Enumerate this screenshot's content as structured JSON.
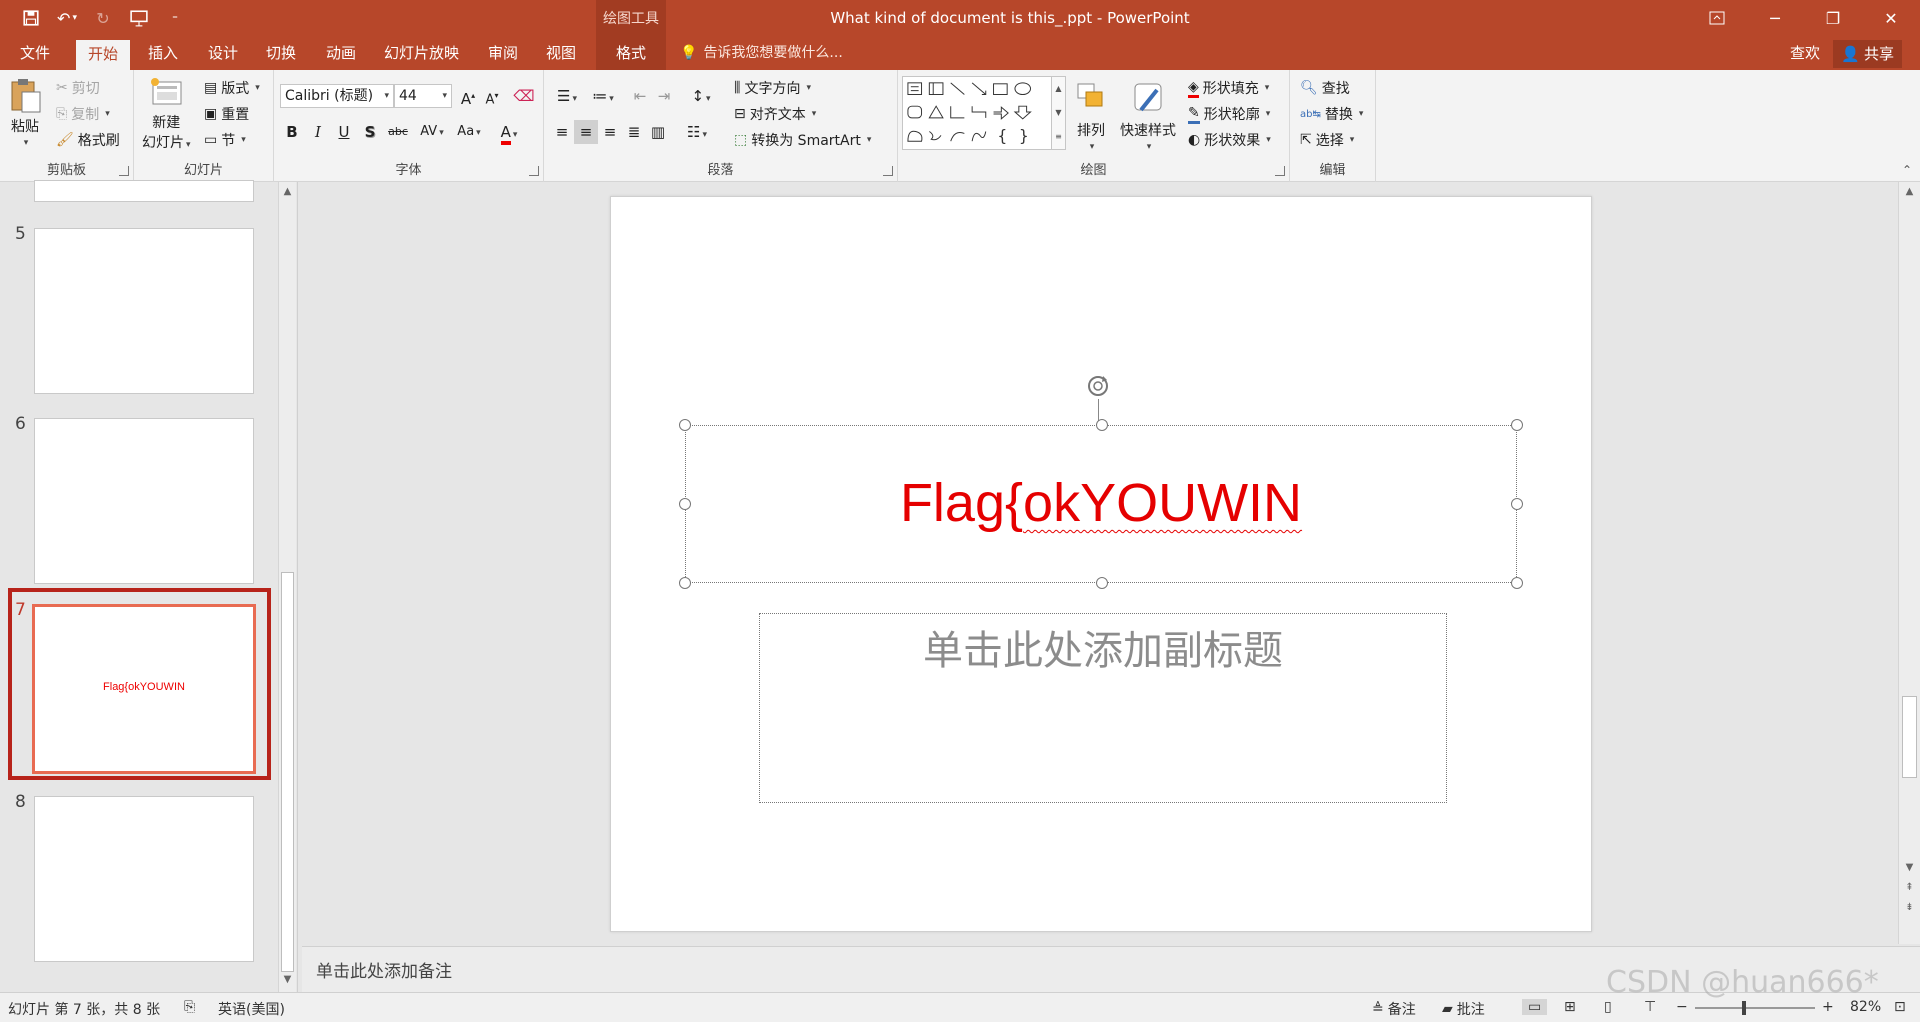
{
  "window": {
    "title": "What kind of document is this_.ppt - PowerPoint",
    "context_tab_group": "绘图工具"
  },
  "tabs": [
    {
      "label": "文件"
    },
    {
      "label": "开始"
    },
    {
      "label": "插入"
    },
    {
      "label": "设计"
    },
    {
      "label": "切换"
    },
    {
      "label": "动画"
    },
    {
      "label": "幻灯片放映"
    },
    {
      "label": "审阅"
    },
    {
      "label": "视图"
    },
    {
      "label": "格式"
    }
  ],
  "tell_me": "告诉我您想要做什么...",
  "review_label": "查欢",
  "share_label": "共享",
  "ribbon": {
    "clipboard": {
      "label": "剪贴板",
      "paste": "粘贴",
      "cut": "剪切",
      "copy": "复制",
      "format_painter": "格式刷"
    },
    "slides": {
      "label": "幻灯片",
      "new_slide_line1": "新建",
      "new_slide_line2": "幻灯片",
      "layout": "版式",
      "reset": "重置",
      "section": "节"
    },
    "font": {
      "label": "字体",
      "font_name": "Calibri (标题)",
      "font_size": "44",
      "grow": "A",
      "shrink": "A",
      "bold": "B",
      "italic": "I",
      "underline": "U",
      "shadow": "S",
      "strike": "abc",
      "spacing": "AV",
      "case": "Aa",
      "color": "A"
    },
    "paragraph": {
      "label": "段落",
      "text_direction": "文字方向",
      "align_text": "对齐文本",
      "smartart": "转换为 SmartArt"
    },
    "drawing": {
      "label": "绘图",
      "arrange": "排列",
      "quick_styles": "快速样式",
      "shape_fill": "形状填充",
      "shape_outline": "形状轮廓",
      "shape_effects": "形状效果"
    },
    "editing": {
      "label": "编辑",
      "find": "查找",
      "replace": "替换",
      "select": "选择"
    }
  },
  "slides": [
    {
      "number": "5",
      "text": ""
    },
    {
      "number": "6",
      "text": ""
    },
    {
      "number": "7",
      "text": "Flag{okYOUWIN",
      "selected": true
    },
    {
      "number": "8",
      "text": ""
    }
  ],
  "current_slide": {
    "title_prefix": "Flag{",
    "title_rest": "okYOUWIN",
    "subtitle_placeholder": "单击此处添加副标题"
  },
  "notes_placeholder": "单击此处添加备注",
  "status": {
    "slide_info": "幻灯片 第 7 张，共 8 张",
    "language": "英语(美国)",
    "notes": "备注",
    "comments": "批注",
    "zoom": "82%"
  },
  "watermark": "CSDN @huan666*",
  "colors": {
    "accent": "#b7472a",
    "title_text": "#e50000",
    "selected_thumb": "#b7231a"
  }
}
